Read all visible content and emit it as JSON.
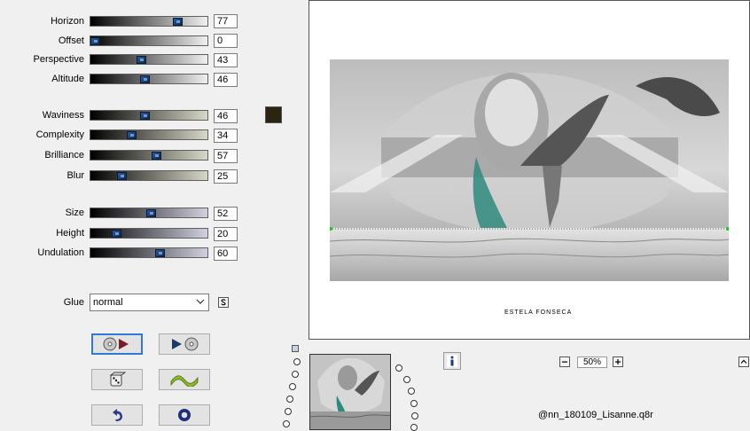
{
  "sliders": [
    {
      "label": "Horizon",
      "value": "77",
      "level": 0.77
    },
    {
      "label": "Offset",
      "value": "0",
      "level": 0.0
    },
    {
      "label": "Perspective",
      "value": "43",
      "level": 0.43
    },
    {
      "label": "Altitude",
      "value": "46",
      "level": 0.46
    },
    {
      "label": "Waviness",
      "value": "46",
      "level": 0.46
    },
    {
      "label": "Complexity",
      "value": "34",
      "level": 0.34
    },
    {
      "label": "Brilliance",
      "value": "57",
      "level": 0.57
    },
    {
      "label": "Blur",
      "value": "25",
      "level": 0.25
    },
    {
      "label": "Size",
      "value": "52",
      "level": 0.52
    },
    {
      "label": "Height",
      "value": "20",
      "level": 0.2
    },
    {
      "label": "Undulation",
      "value": "60",
      "level": 0.6
    }
  ],
  "color_swatch": "#2b2410",
  "glue": {
    "label": "Glue",
    "value": "normal"
  },
  "preview": {
    "credit": "ESTELA FONSECA"
  },
  "zoom": {
    "value": "50%"
  },
  "preset": {
    "name": "@nn_180109_Lisanne.q8r"
  },
  "colors": {
    "accent": "#2f7ad6",
    "knob": "#1b3f78",
    "bg": "#f0f0f0"
  }
}
